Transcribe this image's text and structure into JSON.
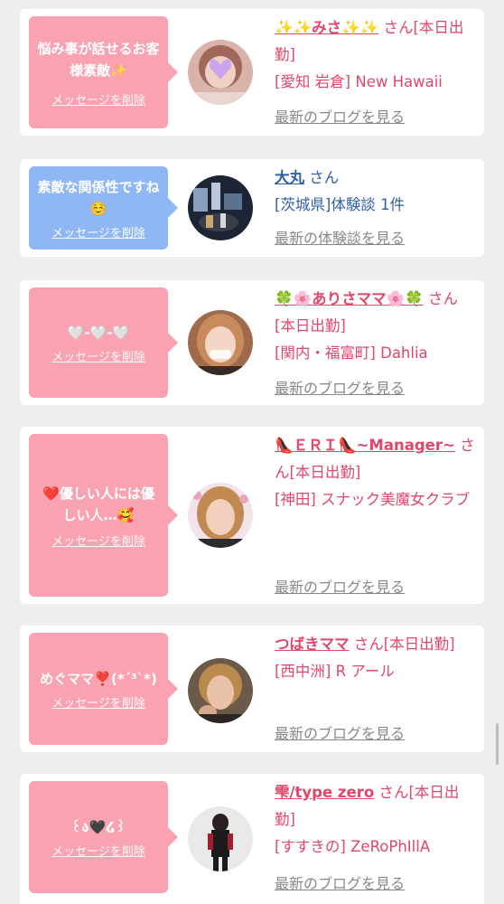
{
  "cards": [
    {
      "message": "悩み事が話せるお客様素敵✨",
      "delete_label": "メッセージを削除",
      "name": "✨✨みさ✨✨",
      "san_suffix": "さん[本日出勤]",
      "location": "[愛知 岩倉] New Hawaii",
      "link": "最新のブログを見る"
    },
    {
      "message": "素敵な関係性ですね☺️",
      "delete_label": "メッセージを削除",
      "name": "大丸",
      "san_suffix": "さん",
      "location": "[茨城県]体験談 1件",
      "link": "最新の体験談を見る"
    },
    {
      "message": "🤍-🤍-🤍",
      "delete_label": "メッセージを削除",
      "name": "🍀🌸ありさママ🌸🍀",
      "san_suffix": "さん[本日出勤]",
      "location": "[関内・福富町] Dahlia",
      "link": "最新のブログを見る"
    },
    {
      "message": "❤️優しい人には優しい人…🥰",
      "delete_label": "メッセージを削除",
      "name": "👠ＥＲＩ👠~Manager~",
      "san_suffix": "さん[本日出勤]",
      "location": "[神田] スナック美魔女クラブ",
      "link": "最新のブログを見る"
    },
    {
      "message": "めぐママ❣️(*´³`*)",
      "delete_label": "メッセージを削除",
      "name": "つばきママ",
      "san_suffix": "さん[本日出勤]",
      "location": "[西中洲] R アール",
      "link": "最新のブログを見る"
    },
    {
      "message": "꒰ა🖤໒꒱",
      "delete_label": "メッセージを削除",
      "name": "雫/type zero",
      "san_suffix": "さん[本日出勤]",
      "location": "[すすきの] ZeRoPhIllA",
      "link": "最新のブログを見る"
    }
  ],
  "colors": {
    "pink_bubble": "#f9a3b2",
    "blue_bubble": "#8fb7f3",
    "accent_pink": "#e0476b",
    "accent_blue": "#2f5fa8",
    "link_gray": "#888888"
  }
}
